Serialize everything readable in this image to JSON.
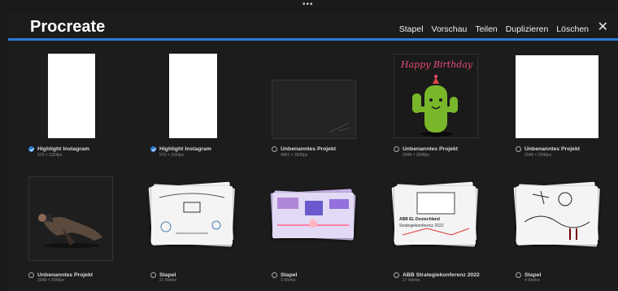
{
  "app": {
    "title": "Procreate"
  },
  "nav": {
    "items": [
      "Stapel",
      "Vorschau",
      "Teilen",
      "Duplizieren",
      "Löschen"
    ],
    "close_icon": "close-icon"
  },
  "colors": {
    "accent": "#2f7ad8",
    "background": "#1c1c1c"
  },
  "gallery": {
    "row1": [
      {
        "title": "Highlight Instagram",
        "sub": "576 × 1024px",
        "selected": true
      },
      {
        "title": "Highlight Instagram",
        "sub": "576 × 1024px",
        "selected": true
      },
      {
        "title": "Unbenanntes Projekt",
        "sub": "4961 × 3508px",
        "selected": false
      },
      {
        "title": "Unbenanntes Projekt",
        "sub": "2048 × 2048px",
        "selected": false,
        "art_text": "Happy Birthday"
      },
      {
        "title": "Unbenanntes Projekt",
        "sub": "2048 × 2048px",
        "selected": false
      }
    ],
    "row2": [
      {
        "title": "Unbenanntes Projekt",
        "sub": "2048 × 2048px",
        "selected": false
      },
      {
        "title": "Stapel",
        "sub": "21 Werke",
        "selected": false
      },
      {
        "title": "Stapel",
        "sub": "3 Werke",
        "selected": false
      },
      {
        "title": "ABB Strategiekonferenz 2022",
        "sub": "17 Werke",
        "selected": false,
        "art_line1": "ABB EL Deutschland",
        "art_line2": "Strategiekonferenz 2022"
      },
      {
        "title": "Stapel",
        "sub": "4 Werke",
        "selected": false
      }
    ]
  }
}
